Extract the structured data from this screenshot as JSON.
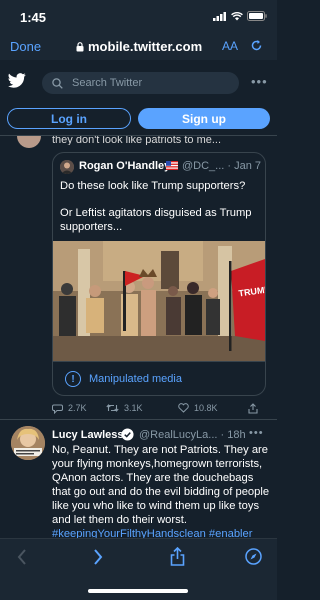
{
  "status_bar": {
    "time": "1:45"
  },
  "browser": {
    "done_label": "Done",
    "url": "mobile.twitter.com",
    "text_size_label": "AA"
  },
  "header": {
    "search_placeholder": "Search Twitter",
    "login_label": "Log in",
    "signup_label": "Sign up",
    "accent": "#5aa3ff",
    "background": "#15202b"
  },
  "feed": {
    "truncated_line": "they don't look like patriots to me...",
    "quote": {
      "name": "Rogan O'Handley",
      "handle": "@DC_...",
      "date": "· Jan 7",
      "line1": "Do these look like Trump supporters?",
      "line2": "Or Leftist agitators disguised as Trump supporters...",
      "flag_text": "TRUMP PRESIDENT",
      "manipulated_label": "Manipulated media"
    },
    "actions": {
      "replies": "2.7K",
      "retweets": "3.1K",
      "likes": "10.8K"
    },
    "tweet2": {
      "name": "Lucy Lawless",
      "handle": "@RealLucyLa...",
      "time": "· 18h",
      "text": "No, Peanut. They are not Patriots. They are your flying monkeys,homegrown terrorists, QAnon actors. They are the douchebags that go out and do the evil bidding of people like you who like to wind them up like toys and let them do their worst.",
      "hashtags": "#keepingYourFilthyHandsclean #enabler"
    }
  },
  "icons": [
    "signal-icon",
    "wifi-icon",
    "battery-icon",
    "lock-icon",
    "refresh-icon",
    "twitter-bird-icon",
    "search-icon",
    "more-icon",
    "reply-icon",
    "retweet-icon",
    "like-icon",
    "share-icon",
    "verified-icon",
    "back-icon",
    "forward-icon",
    "compass-icon"
  ]
}
